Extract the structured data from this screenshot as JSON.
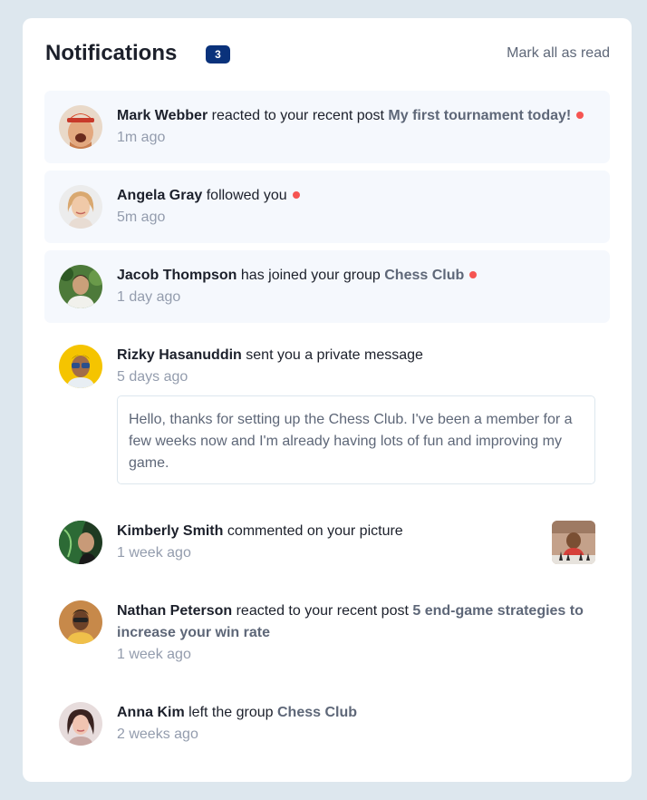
{
  "header": {
    "title": "Notifications",
    "unread_count": "3",
    "mark_all_label": "Mark all as read"
  },
  "colors": {
    "accent_dot": "#f65552",
    "badge_bg": "#0a327b",
    "unread_bg": "#f5f8fd"
  },
  "notifications": [
    {
      "name": "Mark Webber",
      "action": "reacted to your recent post",
      "target": "My first tournament today!",
      "time": "1m ago",
      "unread": true,
      "avatar": "avatar-mark-webber"
    },
    {
      "name": "Angela Gray",
      "action": "followed you",
      "target": "",
      "time": "5m ago",
      "unread": true,
      "avatar": "avatar-angela-gray"
    },
    {
      "name": "Jacob Thompson",
      "action": "has joined your group",
      "target": "Chess Club",
      "time": "1 day ago",
      "unread": true,
      "avatar": "avatar-jacob-thompson"
    },
    {
      "name": "Rizky Hasanuddin",
      "action": "sent you a private message",
      "target": "",
      "time": "5 days ago",
      "unread": false,
      "avatar": "avatar-rizky-hasanuddin",
      "message": "Hello, thanks for setting up the Chess Club. I've been a member for a few weeks now and I'm already having lots of fun and improving my game."
    },
    {
      "name": "Kimberly Smith",
      "action": "commented on your picture",
      "target": "",
      "time": "1 week ago",
      "unread": false,
      "avatar": "avatar-kimberly-smith",
      "thumbnail": "chess-picture-thumbnail"
    },
    {
      "name": "Nathan Peterson",
      "action": "reacted to your recent post",
      "target": "5 end-game strategies to increase your win rate",
      "time": "1 week ago",
      "unread": false,
      "avatar": "avatar-nathan-peterson"
    },
    {
      "name": "Anna Kim",
      "action": "left the group",
      "target": "Chess Club",
      "time": "2 weeks ago",
      "unread": false,
      "avatar": "avatar-anna-kim"
    }
  ]
}
